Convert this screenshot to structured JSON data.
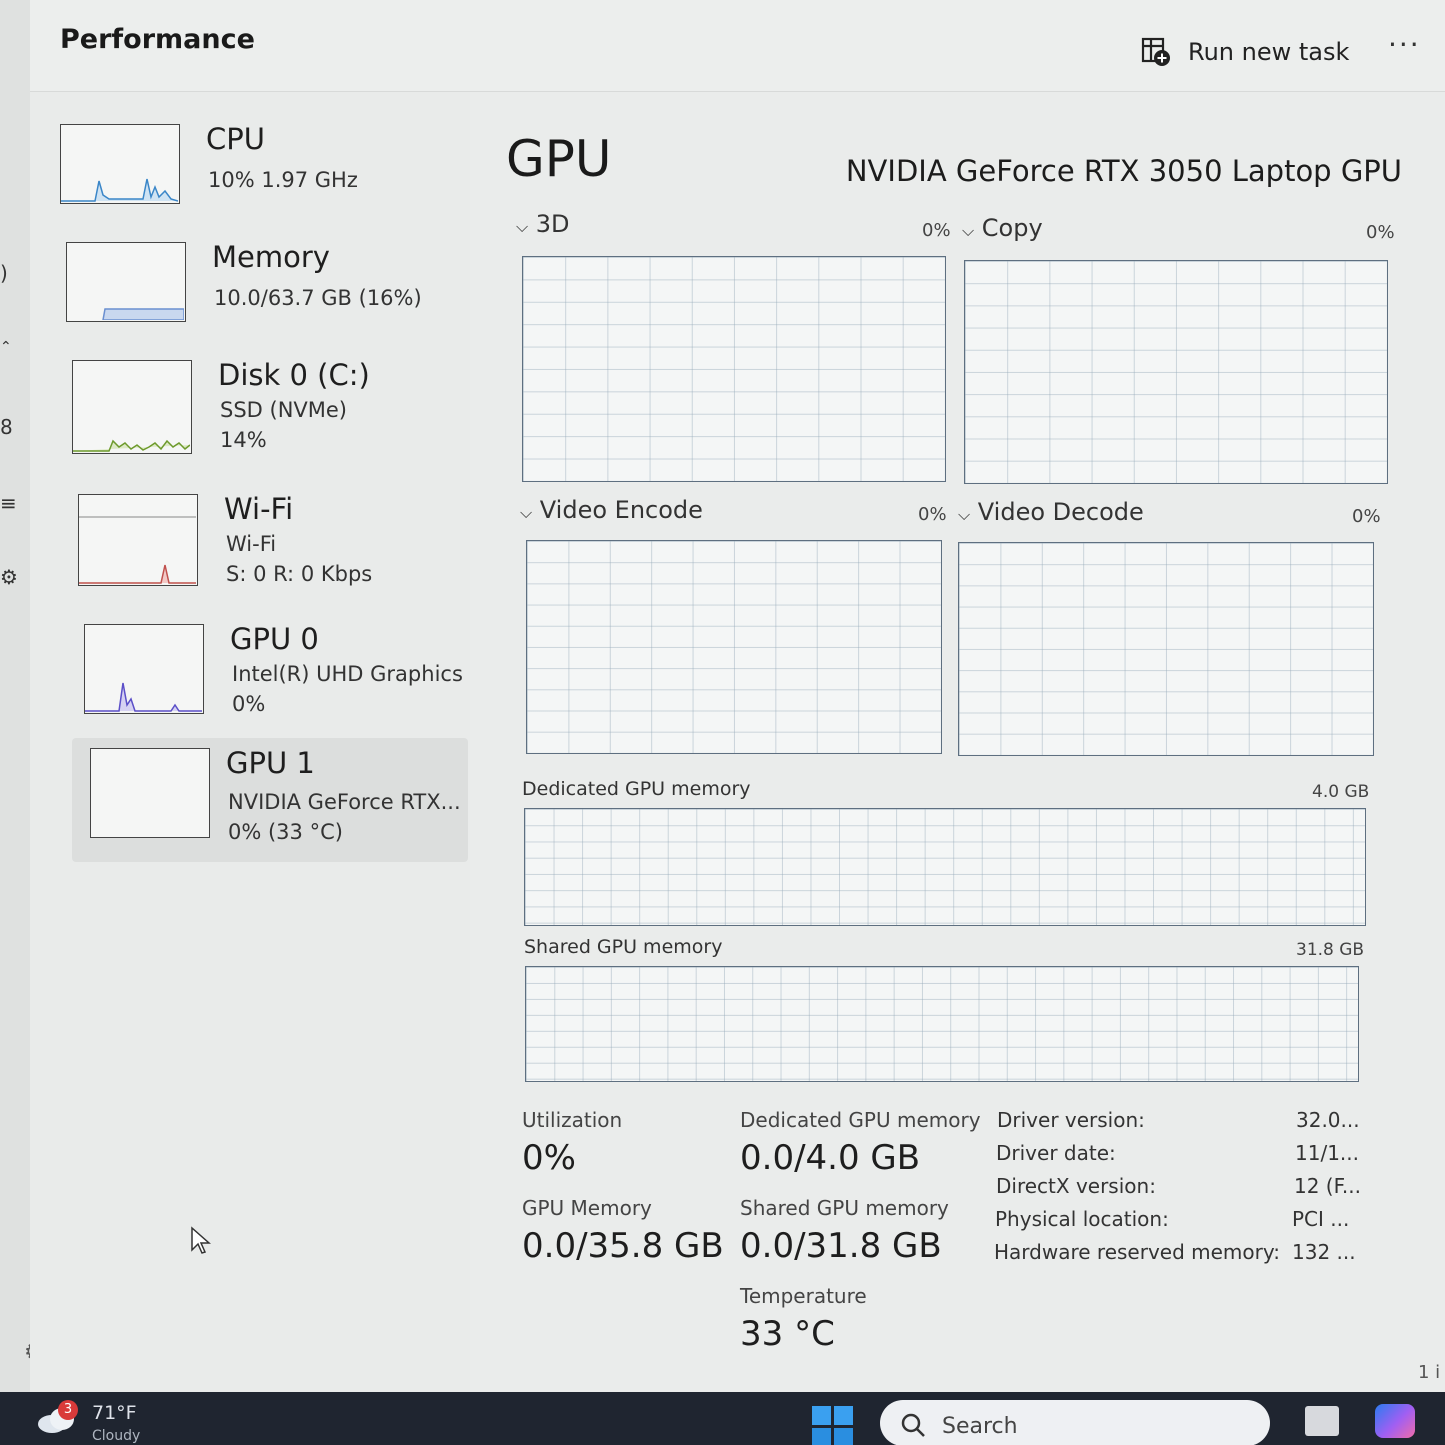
{
  "header": {
    "title": "Performance",
    "run_new_task": "Run new task",
    "more": "···"
  },
  "sidebar": {
    "items": [
      {
        "name": "CPU",
        "sub1": "10%  1.97 GHz",
        "sub2": ""
      },
      {
        "name": "Memory",
        "sub1": "10.0/63.7 GB (16%)",
        "sub2": ""
      },
      {
        "name": "Disk 0 (C:)",
        "sub1": "SSD (NVMe)",
        "sub2": "14%"
      },
      {
        "name": "Wi-Fi",
        "sub1": "Wi-Fi",
        "sub2": "S: 0 R: 0 Kbps"
      },
      {
        "name": "GPU 0",
        "sub1": "Intel(R) UHD Graphics",
        "sub2": "0%"
      },
      {
        "name": "GPU 1",
        "sub1": "NVIDIA GeForce RTX...",
        "sub2": "0%  (33 °C)"
      }
    ],
    "selected_index": 5
  },
  "main": {
    "heading": "GPU",
    "model": "NVIDIA GeForce RTX 3050 Laptop GPU",
    "engines": [
      {
        "label": "3D",
        "pct": "0%"
      },
      {
        "label": "Copy",
        "pct": "0%"
      },
      {
        "label": "Video Encode",
        "pct": "0%"
      },
      {
        "label": "Video Decode",
        "pct": "0%"
      }
    ],
    "dedicated_graph": {
      "label": "Dedicated GPU memory",
      "max": "4.0 GB"
    },
    "shared_graph": {
      "label": "Shared GPU memory",
      "max": "31.8 GB"
    },
    "stats": {
      "utilization_label": "Utilization",
      "utilization_value": "0%",
      "dedicated_label": "Dedicated GPU memory",
      "dedicated_value": "0.0/4.0 GB",
      "gpu_memory_label": "GPU Memory",
      "gpu_memory_value": "0.0/35.8 GB",
      "shared_label": "Shared GPU memory",
      "shared_value": "0.0/31.8 GB",
      "temperature_label": "Temperature",
      "temperature_value": "33 °C"
    },
    "info": [
      {
        "key": "Driver version:",
        "value": "32.0..."
      },
      {
        "key": "Driver date:",
        "value": "11/1..."
      },
      {
        "key": "DirectX version:",
        "value": "12 (F..."
      },
      {
        "key": "Physical location:",
        "value": "PCI ..."
      },
      {
        "key": "Hardware reserved memory:",
        "value": "132 ..."
      }
    ]
  },
  "edge_text": "1 i",
  "taskbar": {
    "weather_badge": "3",
    "weather_temp": "71°F",
    "weather_condition": "Cloudy",
    "search_label": "Search"
  },
  "colors": {
    "accent_cpu": "#3a86c8",
    "accent_memory": "#6a8fd0",
    "accent_disk": "#6d9a2c",
    "accent_wifi": "#c0504d",
    "accent_gpu": "#5b4fc8"
  }
}
